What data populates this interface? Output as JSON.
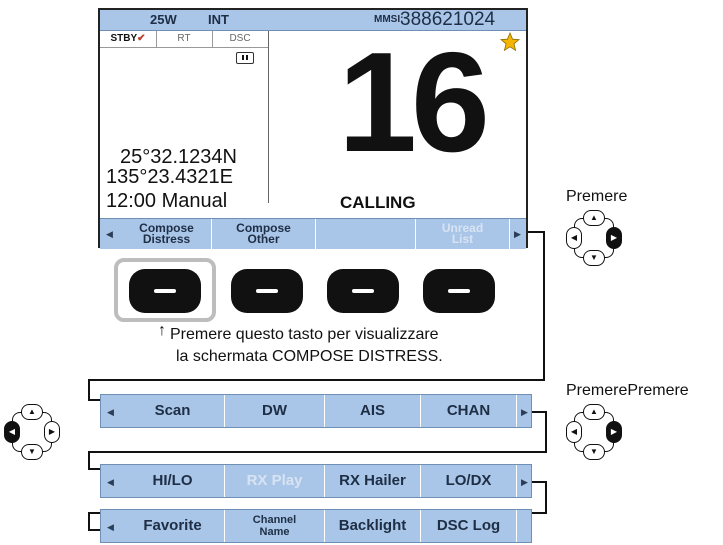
{
  "screen": {
    "status": {
      "power": "25W",
      "mode": "INT",
      "mmsi_label": "MMSI:",
      "mmsi": "388621024"
    },
    "tabs": [
      "STBY",
      "RT",
      "DSC"
    ],
    "stby_check": "✔",
    "pause_icon": "pause-icon",
    "position": {
      "lat": "25°32.1234N",
      "lon": "135°23.4321E",
      "time": "12:00 Manual"
    },
    "channel": "16",
    "channel_status": "CALLING",
    "star_icon": "star-icon",
    "softkeys": [
      {
        "label": "Compose\nDistress"
      },
      {
        "label": "Compose\nOther"
      },
      {
        "label": ""
      },
      {
        "label": "Unread\nList"
      }
    ]
  },
  "note": {
    "arrow": "↑",
    "line1": "Premere questo tasto per visualizzare",
    "line2": "la schermata COMPOSE DISTRESS."
  },
  "labels": {
    "top_right": "Premere",
    "mid_right": "PremerePremere"
  },
  "menu_rows": [
    [
      "Scan",
      "DW",
      "AIS",
      "CHAN"
    ],
    [
      "HI/LO",
      "RX Play",
      "RX Hailer",
      "LO/DX"
    ],
    [
      "Favorite",
      "Channel\nName",
      "Backlight",
      "DSC Log"
    ]
  ],
  "colors": {
    "bar": "#a9c6e8",
    "text": "#1e2e45",
    "dim": "#d8e3f2",
    "star": "#f4b400"
  }
}
